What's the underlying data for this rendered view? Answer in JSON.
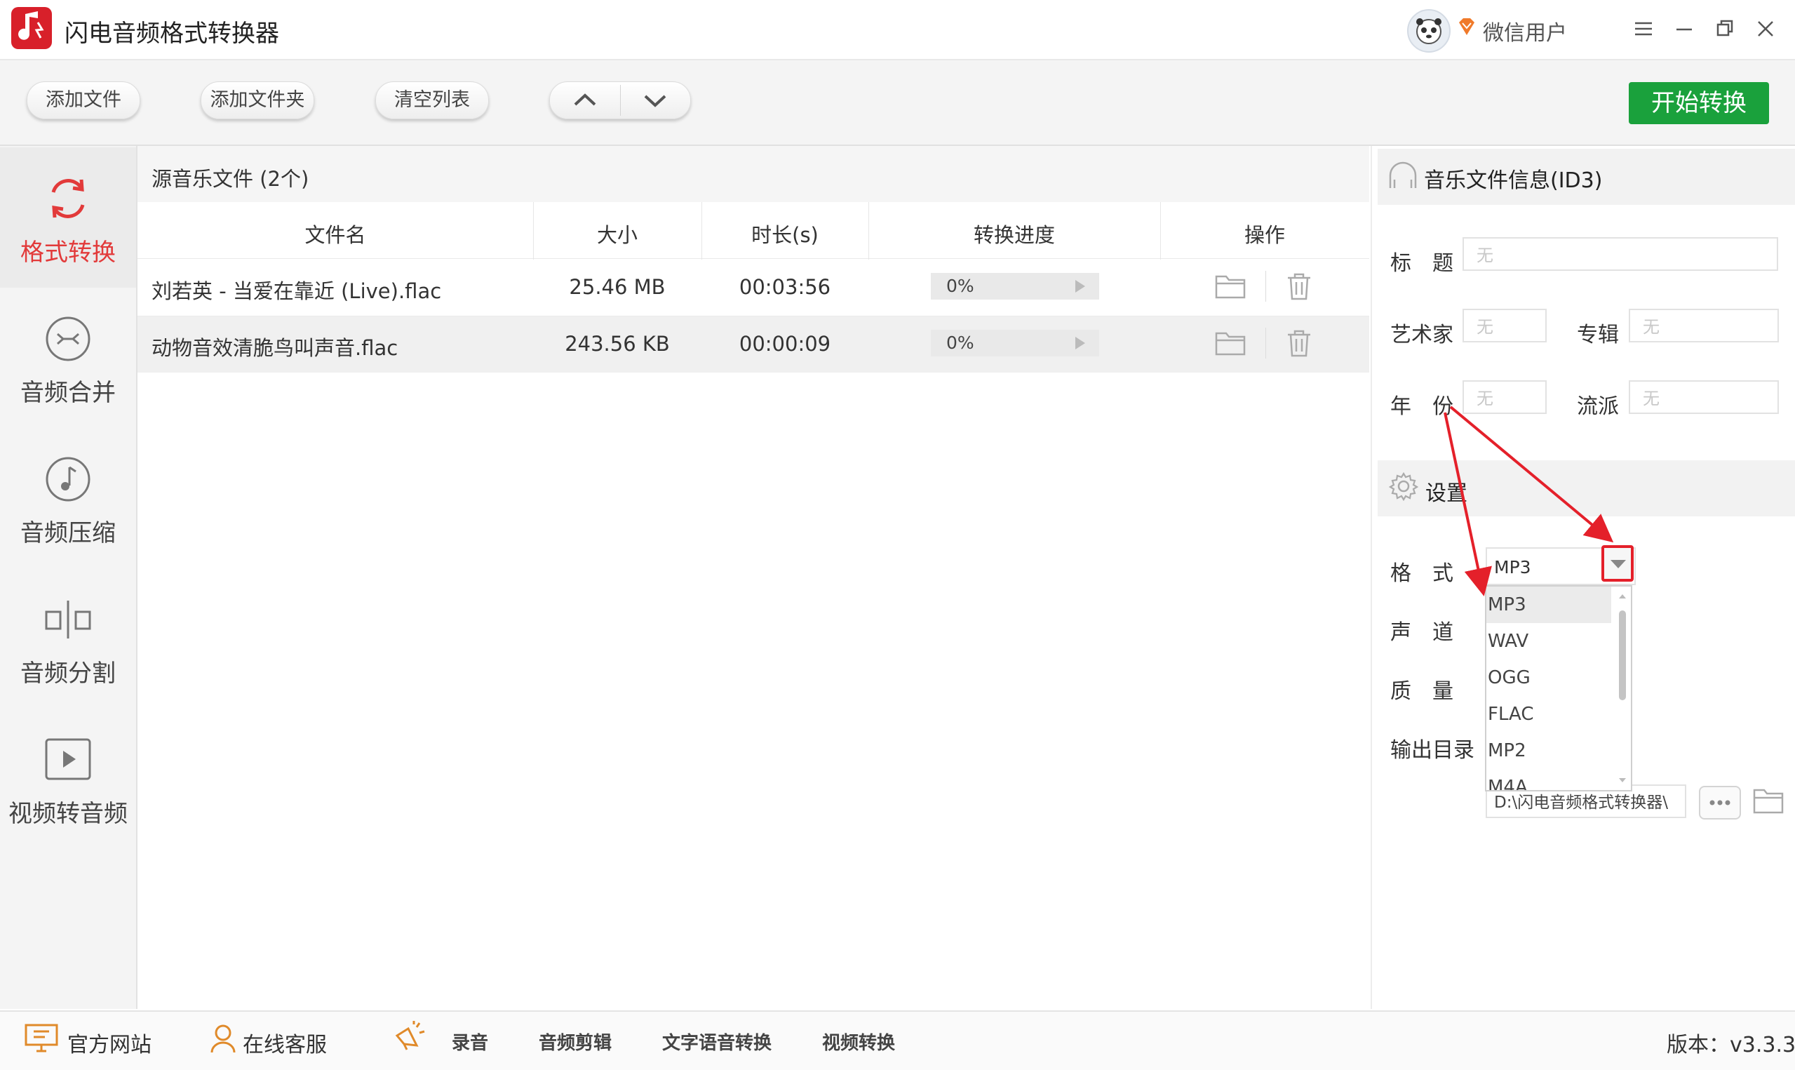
{
  "app": {
    "title": "闪电音频格式转换器",
    "user_name": "微信用户"
  },
  "toolbar": {
    "add_file": "添加文件",
    "add_folder": "添加文件夹",
    "clear_list": "清空列表",
    "start": "开始转换"
  },
  "sidebar": {
    "items": [
      {
        "label": "格式转换",
        "icon": "refresh-icon",
        "active": true
      },
      {
        "label": "音频合并",
        "icon": "merge-icon"
      },
      {
        "label": "音频压缩",
        "icon": "music-note-icon"
      },
      {
        "label": "音频分割",
        "icon": "split-icon"
      },
      {
        "label": "视频转音频",
        "icon": "play-icon"
      }
    ]
  },
  "file_list": {
    "title": "源音乐文件 (2个)",
    "columns": [
      "文件名",
      "大小",
      "时长(s)",
      "转换进度",
      "操作"
    ],
    "rows": [
      {
        "name": "刘若英 - 当爱在靠近 (Live).flac",
        "size": "25.46 MB",
        "duration": "00:03:56",
        "progress": "0%"
      },
      {
        "name": "动物音效清脆鸟叫声音.flac",
        "size": "243.56 KB",
        "duration": "00:00:09",
        "progress": "0%"
      }
    ]
  },
  "id3": {
    "header": "音乐文件信息(ID3)",
    "title_label": "标　题",
    "artist_label": "艺术家",
    "album_label": "专辑",
    "year_label": "年　份",
    "genre_label": "流派",
    "placeholder": "无"
  },
  "settings": {
    "header": "设置",
    "format_label": "格　式",
    "channel_label": "声　道",
    "quality_label": "质　量",
    "output_label": "输出目录",
    "format_value": "MP3",
    "format_options": [
      "MP3",
      "WAV",
      "OGG",
      "FLAC",
      "MP2",
      "M4A"
    ],
    "output_path": "D:\\闪电音频格式转换器\\"
  },
  "bottom": {
    "website": "官方网站",
    "support": "在线客服",
    "record": "录音",
    "audio_edit": "音频剪辑",
    "tts": "文字语音转换",
    "video_convert": "视频转换",
    "version": "版本：v3.3.3"
  },
  "colors": {
    "accent": "#e23a3a",
    "start_button": "#1aa13c",
    "annotation": "#e4202a"
  }
}
